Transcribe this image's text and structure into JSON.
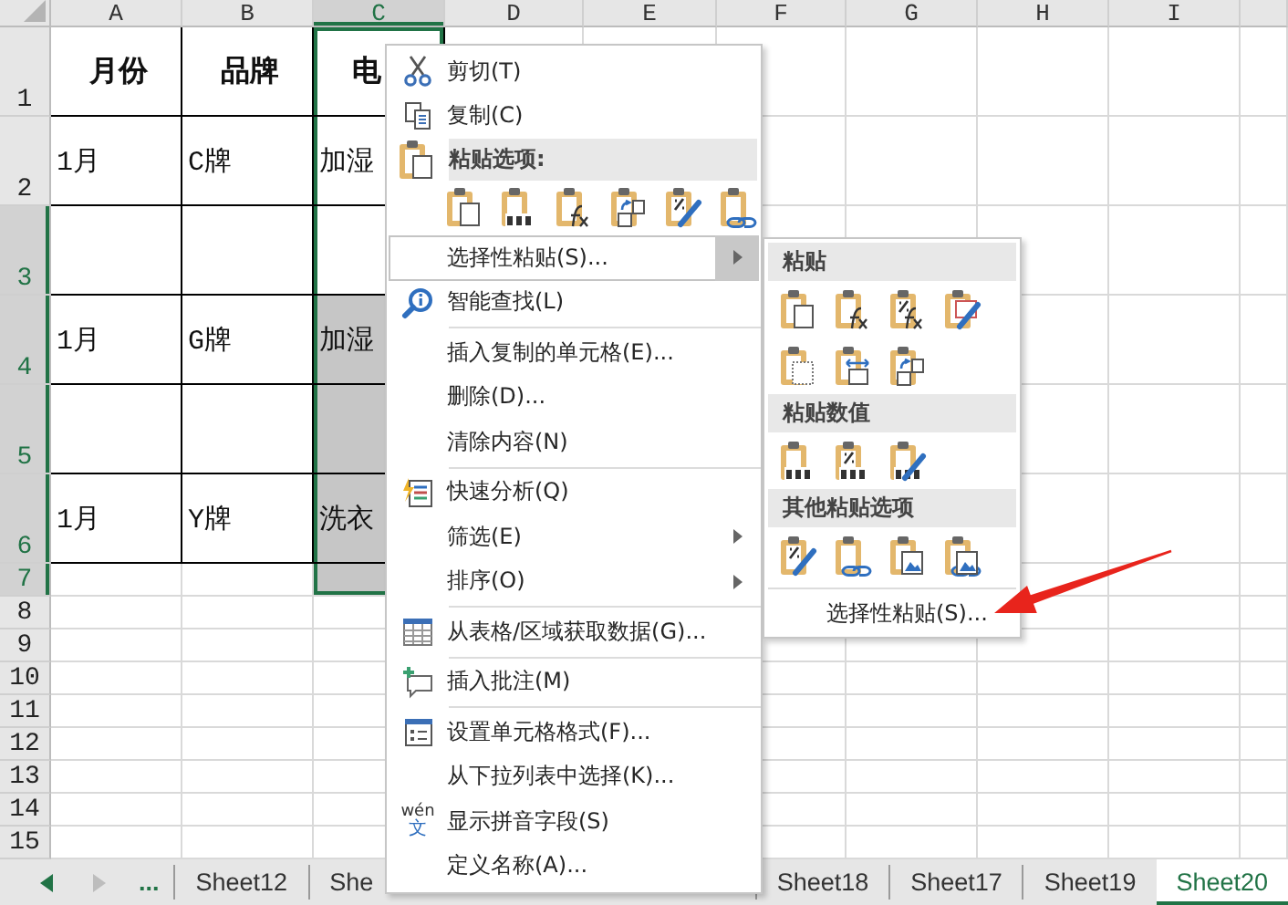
{
  "sheet": {
    "columns": [
      {
        "label": "A",
        "selected": false
      },
      {
        "label": "B",
        "selected": false
      },
      {
        "label": "C",
        "selected": true
      },
      {
        "label": "D",
        "selected": false
      },
      {
        "label": "E",
        "selected": false
      },
      {
        "label": "F",
        "selected": false
      },
      {
        "label": "G",
        "selected": false
      },
      {
        "label": "H",
        "selected": false
      },
      {
        "label": "I",
        "selected": false
      }
    ],
    "rows": [
      {
        "number": "1",
        "selected": false,
        "kind": "header",
        "cells": [
          {
            "text": "月份",
            "shaded": false
          },
          {
            "text": "品牌",
            "shaded": false
          },
          {
            "text": "电",
            "shaded": false
          }
        ]
      },
      {
        "number": "2",
        "selected": false,
        "kind": "data",
        "cells": [
          {
            "text": "1月",
            "shaded": false
          },
          {
            "text": "C牌",
            "shaded": false
          },
          {
            "text": "加湿",
            "shaded": false
          }
        ]
      },
      {
        "number": "3",
        "selected": true,
        "kind": "data",
        "cells": [
          {
            "shaded": false
          },
          {
            "shaded": false
          },
          {
            "shaded": false
          }
        ]
      },
      {
        "number": "4",
        "selected": true,
        "kind": "data",
        "cells": [
          {
            "text": "1月",
            "shaded": false
          },
          {
            "text": "G牌",
            "shaded": false
          },
          {
            "text": "加湿",
            "shaded": true
          }
        ]
      },
      {
        "number": "5",
        "selected": true,
        "kind": "data",
        "cells": [
          {
            "shaded": false
          },
          {
            "shaded": false
          },
          {
            "shaded": true
          }
        ]
      },
      {
        "number": "6",
        "selected": true,
        "kind": "data",
        "cells": [
          {
            "text": "1月",
            "shaded": false
          },
          {
            "text": "Y牌",
            "shaded": false
          },
          {
            "text": "洗衣",
            "shaded": true
          }
        ]
      },
      {
        "number": "7",
        "selected": true,
        "kind": "data",
        "cells": [
          {
            "shaded": false
          },
          {
            "shaded": false
          },
          {
            "shaded": true
          }
        ]
      },
      {
        "number": "8",
        "selected": false,
        "kind": "data",
        "cells": []
      },
      {
        "number": "9",
        "selected": false,
        "kind": "data",
        "cells": []
      },
      {
        "number": "10",
        "selected": false,
        "kind": "data",
        "cells": []
      },
      {
        "number": "11",
        "selected": false,
        "kind": "data",
        "cells": []
      },
      {
        "number": "12",
        "selected": false,
        "kind": "data",
        "cells": []
      },
      {
        "number": "13",
        "selected": false,
        "kind": "data",
        "cells": []
      },
      {
        "number": "14",
        "selected": false,
        "kind": "data",
        "cells": []
      },
      {
        "number": "15",
        "selected": false,
        "kind": "data",
        "cells": []
      }
    ]
  },
  "context_menu": {
    "items": [
      {
        "kind": "item",
        "label": "剪切(T)",
        "selected": false
      },
      {
        "kind": "item",
        "label": "复制(C)",
        "selected": false
      },
      {
        "kind": "header",
        "label": "粘贴选项:"
      },
      {
        "kind": "icon_row"
      },
      {
        "kind": "item",
        "label": "选择性粘贴(S)...",
        "selected": true,
        "submenu": true
      },
      {
        "kind": "item",
        "label": "智能查找(L)",
        "selected": false
      },
      {
        "kind": "separator"
      },
      {
        "kind": "item",
        "label": "插入复制的单元格(E)...",
        "selected": false
      },
      {
        "kind": "item",
        "label": "删除(D)...",
        "selected": false
      },
      {
        "kind": "item",
        "label": "清除内容(N)",
        "selected": false
      },
      {
        "kind": "separator"
      },
      {
        "kind": "item",
        "label": "快速分析(Q)",
        "selected": false
      },
      {
        "kind": "item",
        "label": "筛选(E)",
        "selected": false,
        "submenu": true
      },
      {
        "kind": "item",
        "label": "排序(O)",
        "selected": false,
        "submenu": true
      },
      {
        "kind": "separator"
      },
      {
        "kind": "item",
        "label": "从表格/区域获取数据(G)...",
        "selected": false
      },
      {
        "kind": "separator"
      },
      {
        "kind": "item",
        "label": "插入批注(M)",
        "selected": false
      },
      {
        "kind": "separator"
      },
      {
        "kind": "item",
        "label": "设置单元格格式(F)...",
        "selected": false
      },
      {
        "kind": "item",
        "label": "从下拉列表中选择(K)...",
        "selected": false
      },
      {
        "kind": "item",
        "label": "显示拼音字段(S)",
        "selected": false,
        "icon_text": [
          "wén",
          "文"
        ]
      },
      {
        "kind": "item",
        "label": "定义名称(A)...",
        "selected": false
      }
    ]
  },
  "paste_submenu": {
    "sections": [
      {
        "title": "粘贴"
      },
      {
        "title": "粘贴数值"
      },
      {
        "title": "其他粘贴选项"
      }
    ],
    "footer": {
      "label": "选择性粘贴(S)...",
      "selected": false
    }
  },
  "sheet_tabs": {
    "more": "...",
    "tabs": [
      {
        "label": "Sheet12",
        "selected": false
      },
      {
        "label": "She",
        "selected": false
      },
      {
        "label": "Sheet18",
        "selected": false
      },
      {
        "label": "Sheet17",
        "selected": false
      },
      {
        "label": "Sheet19",
        "selected": false
      },
      {
        "label": "Sheet20",
        "selected": true
      }
    ]
  }
}
